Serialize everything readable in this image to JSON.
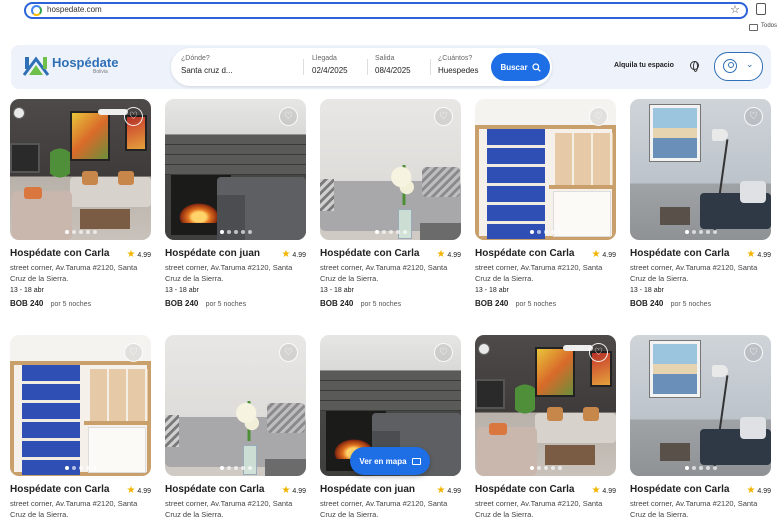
{
  "browser": {
    "url": "hospedate.com",
    "bookmarks_label": "Todos"
  },
  "header": {
    "brand": "Hospédate",
    "brand_sub": "Bolivia",
    "search": {
      "where_label": "¿Dónde?",
      "where_value": "Santa cruz d...",
      "checkin_label": "Llegada",
      "checkin_value": "02/4/2025",
      "checkout_label": "Salida",
      "checkout_value": "08/4/2025",
      "guests_label": "¿Cuántos?",
      "guests_value": "Huespedes",
      "button": "Buscar"
    },
    "host_link": "Alquila tu espacio",
    "icons": {
      "globe": "globe-icon",
      "user": "user-icon",
      "menu": "chevron-down-icon"
    }
  },
  "colors": {
    "accent": "#1e6ee6",
    "brand": "#2f6fb5",
    "star": "#f2b400"
  },
  "listings": [
    {
      "title": "Hospédate con Carla",
      "rating": "4.99",
      "address": "street corner, Av.Taruma #2120, Santa Cruz de la Sierra.",
      "dates": "13 - 18 abr",
      "price": "BOB 240",
      "per": "por 5 noches",
      "scene": "living"
    },
    {
      "title": "Hospédate con juan",
      "rating": "4.99",
      "address": "street corner, Av.Taruma #2120, Santa Cruz de la Sierra.",
      "dates": "13 - 18 abr",
      "price": "BOB 240",
      "per": "por 5 noches",
      "scene": "fire"
    },
    {
      "title": "Hospédate con Carla",
      "rating": "4.99",
      "address": "street corner, Av.Taruma #2120, Santa Cruz de la Sierra.",
      "dates": "13 - 18 abr",
      "price": "BOB 240",
      "per": "por 5 noches",
      "scene": "couch"
    },
    {
      "title": "Hospédate con Carla",
      "rating": "4.99",
      "address": "street corner, Av.Taruma #2120, Santa Cruz de la Sierra.",
      "dates": "13 - 18 abr",
      "price": "BOB 240",
      "per": "por 5 noches",
      "scene": "shelf"
    },
    {
      "title": "Hospédate con Carla",
      "rating": "4.99",
      "address": "street corner, Av.Taruma #2120, Santa Cruz de la Sierra.",
      "dates": "13 - 18 abr",
      "price": "BOB 240",
      "per": "por 5 noches",
      "scene": "room"
    },
    {
      "title": "Hospédate con Carla",
      "rating": "4.99",
      "address": "street corner, Av.Taruma #2120, Santa Cruz de la Sierra.",
      "dates": "",
      "price": "",
      "per": "",
      "scene": "shelf"
    },
    {
      "title": "Hospédate con Carla",
      "rating": "4.99",
      "address": "street corner, Av.Taruma #2120, Santa Cruz de la Sierra.",
      "dates": "",
      "price": "",
      "per": "",
      "scene": "couch"
    },
    {
      "title": "Hospédate con juan",
      "rating": "4.99",
      "address": "street corner, Av.Taruma #2120, Santa Cruz de la Sierra.",
      "dates": "",
      "price": "",
      "per": "",
      "scene": "fire"
    },
    {
      "title": "Hospédate con Carla",
      "rating": "4.99",
      "address": "street corner, Av.Taruma #2120, Santa Cruz de la Sierra.",
      "dates": "",
      "price": "",
      "per": "",
      "scene": "living"
    },
    {
      "title": "Hospédate con Carla",
      "rating": "4.99",
      "address": "street corner, Av.Taruma #2120, Santa Cruz de la Sierra.",
      "dates": "",
      "price": "",
      "per": "",
      "scene": "room"
    }
  ],
  "map_button": "Ver en mapa"
}
